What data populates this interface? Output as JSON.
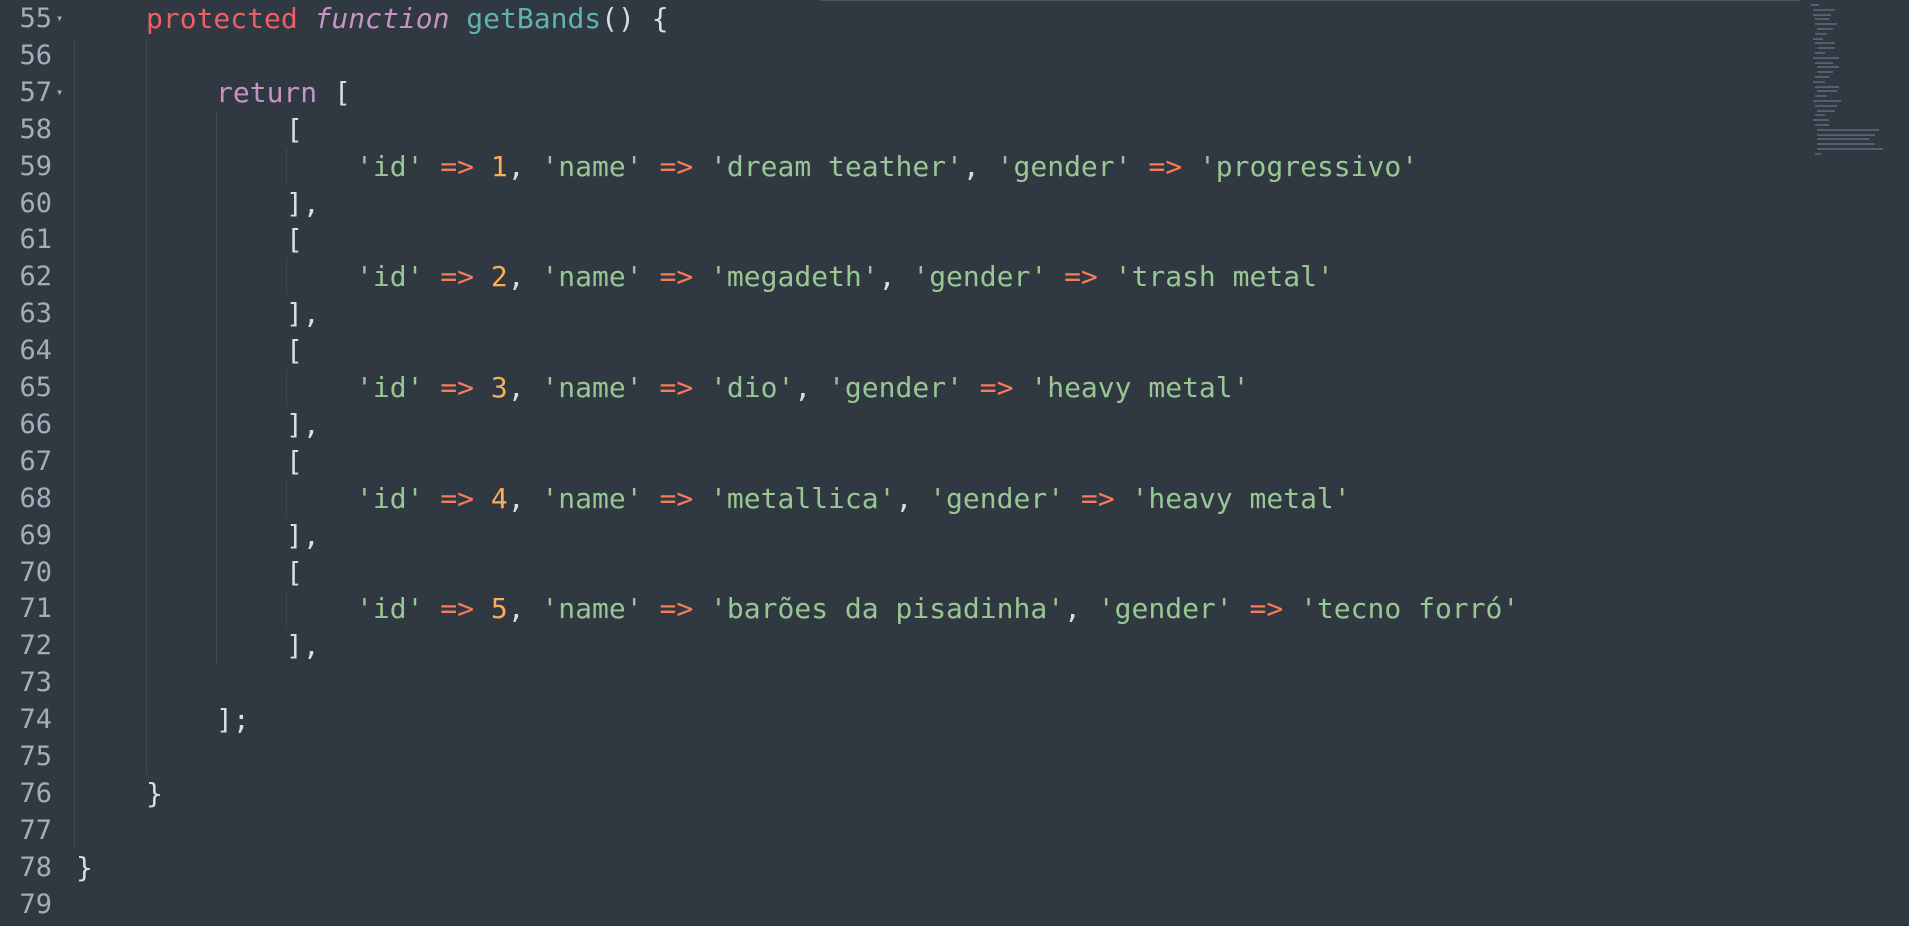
{
  "editor": {
    "lines": [
      {
        "n": "55",
        "fold": "▾",
        "indent": 1,
        "tokens": [
          [
            "kw-red",
            "protected"
          ],
          [
            "punc",
            " "
          ],
          [
            "fn-italic",
            "function"
          ],
          [
            "punc",
            " "
          ],
          [
            "fn-name",
            "getBands"
          ],
          [
            "punc",
            "() {"
          ]
        ]
      },
      {
        "n": "56",
        "fold": "",
        "indent": 0,
        "tokens": []
      },
      {
        "n": "57",
        "fold": "▾",
        "indent": 2,
        "tokens": [
          [
            "kw-purple",
            "return"
          ],
          [
            "punc",
            " ["
          ]
        ]
      },
      {
        "n": "58",
        "fold": "",
        "indent": 3,
        "tokens": [
          [
            "punc",
            "["
          ]
        ]
      },
      {
        "n": "59",
        "fold": "",
        "indent": 4,
        "tokens": [
          [
            "str",
            "'id'"
          ],
          [
            "punc",
            " "
          ],
          [
            "op",
            "=>"
          ],
          [
            "punc",
            " "
          ],
          [
            "num",
            "1"
          ],
          [
            "punc",
            ", "
          ],
          [
            "str",
            "'name'"
          ],
          [
            "punc",
            " "
          ],
          [
            "op",
            "=>"
          ],
          [
            "punc",
            " "
          ],
          [
            "str",
            "'dream teather'"
          ],
          [
            "punc",
            ", "
          ],
          [
            "str",
            "'gender'"
          ],
          [
            "punc",
            " "
          ],
          [
            "op",
            "=>"
          ],
          [
            "punc",
            " "
          ],
          [
            "str",
            "'progressivo'"
          ]
        ]
      },
      {
        "n": "60",
        "fold": "",
        "indent": 3,
        "tokens": [
          [
            "punc",
            "],"
          ]
        ]
      },
      {
        "n": "61",
        "fold": "",
        "indent": 3,
        "tokens": [
          [
            "punc",
            "["
          ]
        ]
      },
      {
        "n": "62",
        "fold": "",
        "indent": 4,
        "tokens": [
          [
            "str",
            "'id'"
          ],
          [
            "punc",
            " "
          ],
          [
            "op",
            "=>"
          ],
          [
            "punc",
            " "
          ],
          [
            "num",
            "2"
          ],
          [
            "punc",
            ", "
          ],
          [
            "str",
            "'name'"
          ],
          [
            "punc",
            " "
          ],
          [
            "op",
            "=>"
          ],
          [
            "punc",
            " "
          ],
          [
            "str",
            "'megadeth'"
          ],
          [
            "punc",
            ", "
          ],
          [
            "str",
            "'gender'"
          ],
          [
            "punc",
            " "
          ],
          [
            "op",
            "=>"
          ],
          [
            "punc",
            " "
          ],
          [
            "str",
            "'trash metal'"
          ]
        ]
      },
      {
        "n": "63",
        "fold": "",
        "indent": 3,
        "tokens": [
          [
            "punc",
            "],"
          ]
        ]
      },
      {
        "n": "64",
        "fold": "",
        "indent": 3,
        "tokens": [
          [
            "punc",
            "["
          ]
        ]
      },
      {
        "n": "65",
        "fold": "",
        "indent": 4,
        "tokens": [
          [
            "str",
            "'id'"
          ],
          [
            "punc",
            " "
          ],
          [
            "op",
            "=>"
          ],
          [
            "punc",
            " "
          ],
          [
            "num",
            "3"
          ],
          [
            "punc",
            ", "
          ],
          [
            "str",
            "'name'"
          ],
          [
            "punc",
            " "
          ],
          [
            "op",
            "=>"
          ],
          [
            "punc",
            " "
          ],
          [
            "str",
            "'dio'"
          ],
          [
            "punc",
            ", "
          ],
          [
            "str",
            "'gender'"
          ],
          [
            "punc",
            " "
          ],
          [
            "op",
            "=>"
          ],
          [
            "punc",
            " "
          ],
          [
            "str",
            "'heavy metal'"
          ]
        ]
      },
      {
        "n": "66",
        "fold": "",
        "indent": 3,
        "tokens": [
          [
            "punc",
            "],"
          ]
        ]
      },
      {
        "n": "67",
        "fold": "",
        "indent": 3,
        "tokens": [
          [
            "punc",
            "["
          ]
        ]
      },
      {
        "n": "68",
        "fold": "",
        "indent": 4,
        "tokens": [
          [
            "str",
            "'id'"
          ],
          [
            "punc",
            " "
          ],
          [
            "op",
            "=>"
          ],
          [
            "punc",
            " "
          ],
          [
            "num",
            "4"
          ],
          [
            "punc",
            ", "
          ],
          [
            "str",
            "'name'"
          ],
          [
            "punc",
            " "
          ],
          [
            "op",
            "=>"
          ],
          [
            "punc",
            " "
          ],
          [
            "str",
            "'metallica'"
          ],
          [
            "punc",
            ", "
          ],
          [
            "str",
            "'gender'"
          ],
          [
            "punc",
            " "
          ],
          [
            "op",
            "=>"
          ],
          [
            "punc",
            " "
          ],
          [
            "str",
            "'heavy metal'"
          ]
        ]
      },
      {
        "n": "69",
        "fold": "",
        "indent": 3,
        "tokens": [
          [
            "punc",
            "],"
          ]
        ]
      },
      {
        "n": "70",
        "fold": "",
        "indent": 3,
        "tokens": [
          [
            "punc",
            "["
          ]
        ]
      },
      {
        "n": "71",
        "fold": "",
        "indent": 4,
        "tokens": [
          [
            "str",
            "'id'"
          ],
          [
            "punc",
            " "
          ],
          [
            "op",
            "=>"
          ],
          [
            "punc",
            " "
          ],
          [
            "num",
            "5"
          ],
          [
            "punc",
            ", "
          ],
          [
            "str",
            "'name'"
          ],
          [
            "punc",
            " "
          ],
          [
            "op",
            "=>"
          ],
          [
            "punc",
            " "
          ],
          [
            "str",
            "'barões da pisadinha'"
          ],
          [
            "punc",
            ", "
          ],
          [
            "str",
            "'gender'"
          ],
          [
            "punc",
            " "
          ],
          [
            "op",
            "=>"
          ],
          [
            "punc",
            " "
          ],
          [
            "str",
            "'tecno forró'"
          ]
        ]
      },
      {
        "n": "72",
        "fold": "",
        "indent": 3,
        "tokens": [
          [
            "punc",
            "],"
          ]
        ]
      },
      {
        "n": "73",
        "fold": "",
        "indent": 0,
        "tokens": []
      },
      {
        "n": "74",
        "fold": "",
        "indent": 2,
        "tokens": [
          [
            "punc",
            "];"
          ]
        ]
      },
      {
        "n": "75",
        "fold": "",
        "indent": 0,
        "tokens": []
      },
      {
        "n": "76",
        "fold": "",
        "indent": 1,
        "tokens": [
          [
            "punc",
            "}"
          ]
        ]
      },
      {
        "n": "77",
        "fold": "",
        "indent": 0,
        "tokens": []
      },
      {
        "n": "78",
        "fold": "",
        "indent": 0,
        "tokens": [
          [
            "punc",
            "}"
          ]
        ]
      },
      {
        "n": "79",
        "fold": "",
        "indent": 0,
        "tokens": []
      }
    ]
  },
  "colors": {
    "background": "#303841",
    "line_number": "#a6acb9",
    "keyword_red": "#ec5f67",
    "keyword_purple": "#c594c5",
    "function_name": "#5fb3b3",
    "string": "#99c794",
    "number": "#f9ae58",
    "operator": "#f97b58",
    "text": "#d8dee9"
  }
}
